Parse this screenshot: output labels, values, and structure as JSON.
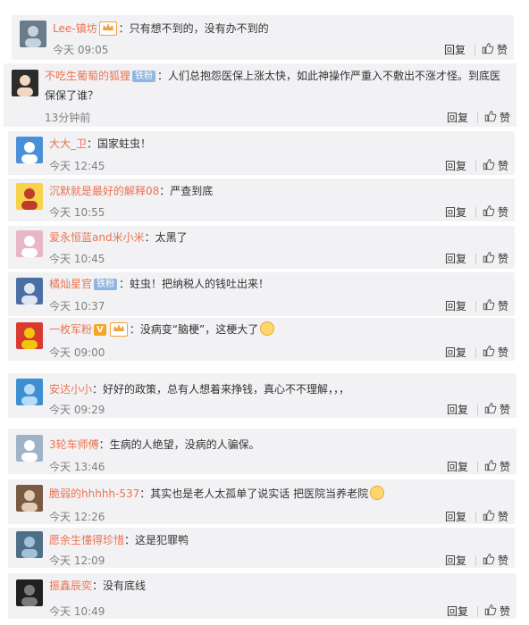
{
  "comments": [
    {
      "user": "Lee-镇坊",
      "badges": [
        "vip"
      ],
      "text": "只有想不到的，没有办不到的",
      "emoji": false,
      "time": "今天 09:05"
    },
    {
      "user": "不吃生葡萄的狐狸",
      "badges": [
        "fan"
      ],
      "fan_label": "铁粉",
      "text": "人们总抱怨医保上涨太快，如此神操作严重入不敷出不涨才怪。到底医保保了谁？",
      "emoji": false,
      "time": "13分钟前"
    },
    {
      "user": "大大_卫",
      "badges": [],
      "text": "国家蛀虫！",
      "emoji": false,
      "time": "今天 12:45"
    },
    {
      "user": "沉默就是最好的解释08",
      "badges": [],
      "text": "严查到底",
      "emoji": false,
      "time": "今天 10:55"
    },
    {
      "user": "爱永恒蓝and米小米",
      "badges": [],
      "text": "太黑了",
      "emoji": false,
      "time": "今天 10:45"
    },
    {
      "user": "橘灿星官",
      "badges": [
        "fan"
      ],
      "fan_label": "铁粉",
      "text": "蛀虫！把纳税人的钱吐出来！",
      "emoji": false,
      "time": "今天 10:37"
    },
    {
      "user": "一枚军粉",
      "badges": [
        "v",
        "vip"
      ],
      "v_label": "V",
      "text": "没病变“脑梗”，这梗大了",
      "emoji": true,
      "time": "今天 09:00"
    },
    {
      "user": "安达小小",
      "badges": [],
      "text": "好好的政策，总有人想着来挣钱，真心不不理解，，，",
      "emoji": false,
      "time": "今天 09:29"
    },
    {
      "user": "3轮车师傅",
      "badges": [],
      "text": "生病的人绝望，没病的人骗保。",
      "emoji": false,
      "time": "今天 13:46"
    },
    {
      "user": "脆弱的hhhhh-537",
      "badges": [],
      "text": "其实也是老人太孤单了说实话 把医院当养老院",
      "emoji": true,
      "time": "今天 12:26"
    },
    {
      "user": "愿余生懂得珍惜",
      "badges": [],
      "text": "这是犯罪鸭",
      "emoji": false,
      "time": "今天 12:09"
    },
    {
      "user": "振鑫辰奕",
      "badges": [],
      "text": "没有底线",
      "emoji": false,
      "time": "今天 10:49"
    }
  ],
  "actions": {
    "reply_label": "回复",
    "like_label": "赞",
    "like_icon": "thumbs-up-icon"
  },
  "colors": {
    "username": "#eb7350",
    "row_bg": "#f2f2f5",
    "time": "#808080"
  }
}
